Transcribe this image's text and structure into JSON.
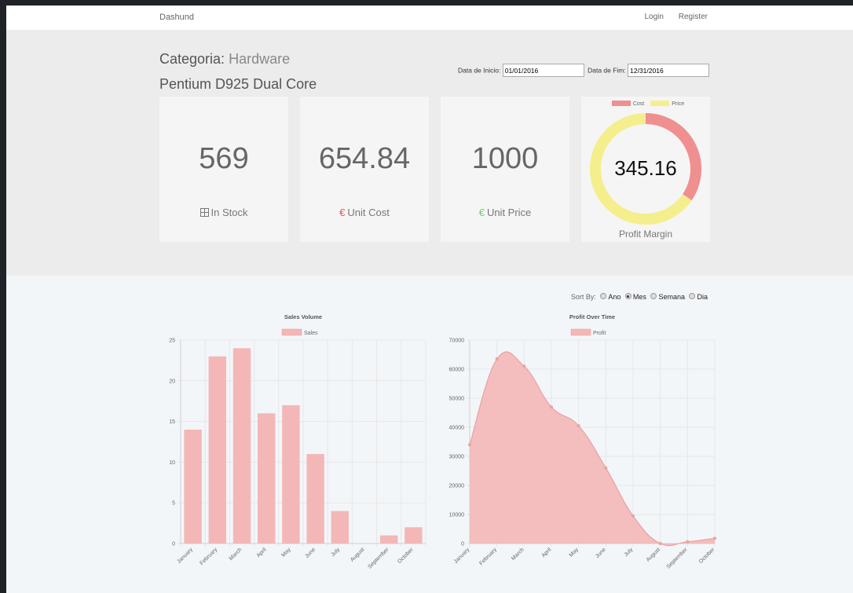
{
  "nav": {
    "brand": "Dashund",
    "login": "Login",
    "register": "Register"
  },
  "header": {
    "category_label": "Categoria:",
    "category_value": "Hardware",
    "product_name": "Pentium D925 Dual Core",
    "start_label": "Data de Inicio:",
    "start_value": "01/01/2016",
    "end_label": "Data de Fim:",
    "end_value": "12/31/2016"
  },
  "cards": {
    "stock": {
      "value": "569",
      "label": "In Stock",
      "icon": "grid-icon"
    },
    "cost": {
      "value": "654.84",
      "label": "Unit Cost",
      "icon": "euro-icon"
    },
    "price": {
      "value": "1000",
      "label": "Unit Price",
      "icon": "euro-icon"
    }
  },
  "margin": {
    "value": "345.16",
    "label": "Profit Margin",
    "legend": [
      "Cost",
      "Price"
    ],
    "colors": {
      "cost": "#f08f8f",
      "price": "#f4ef8c"
    }
  },
  "sortby": {
    "label": "Sort By:",
    "options": [
      "Ano",
      "Mes",
      "Semana",
      "Dia"
    ],
    "selected": "Mes"
  },
  "chart_data": [
    {
      "type": "bar",
      "title": "Sales Volume",
      "categories": [
        "January",
        "February",
        "March",
        "April",
        "May",
        "June",
        "July",
        "August",
        "September",
        "October"
      ],
      "series": [
        {
          "name": "Sales",
          "values": [
            14,
            23,
            24,
            16,
            17,
            11,
            4,
            0,
            1,
            2
          ]
        }
      ],
      "ylim": [
        0,
        25
      ],
      "yticks": [
        0,
        5,
        10,
        15,
        20,
        25
      ],
      "grid": true,
      "legend": "top",
      "color": "#f4b7b7"
    },
    {
      "type": "area",
      "title": "Profit Over Time",
      "categories": [
        "January",
        "February",
        "March",
        "April",
        "May",
        "June",
        "July",
        "August",
        "September",
        "October"
      ],
      "series": [
        {
          "name": "Profit",
          "values": [
            34000,
            63500,
            61000,
            47000,
            40500,
            26000,
            9500,
            0,
            600,
            1800
          ]
        }
      ],
      "ylim": [
        0,
        70000
      ],
      "yticks": [
        0,
        10000,
        20000,
        30000,
        40000,
        50000,
        60000,
        70000
      ],
      "grid": true,
      "legend": "top",
      "color": "#f4b7b7"
    }
  ]
}
